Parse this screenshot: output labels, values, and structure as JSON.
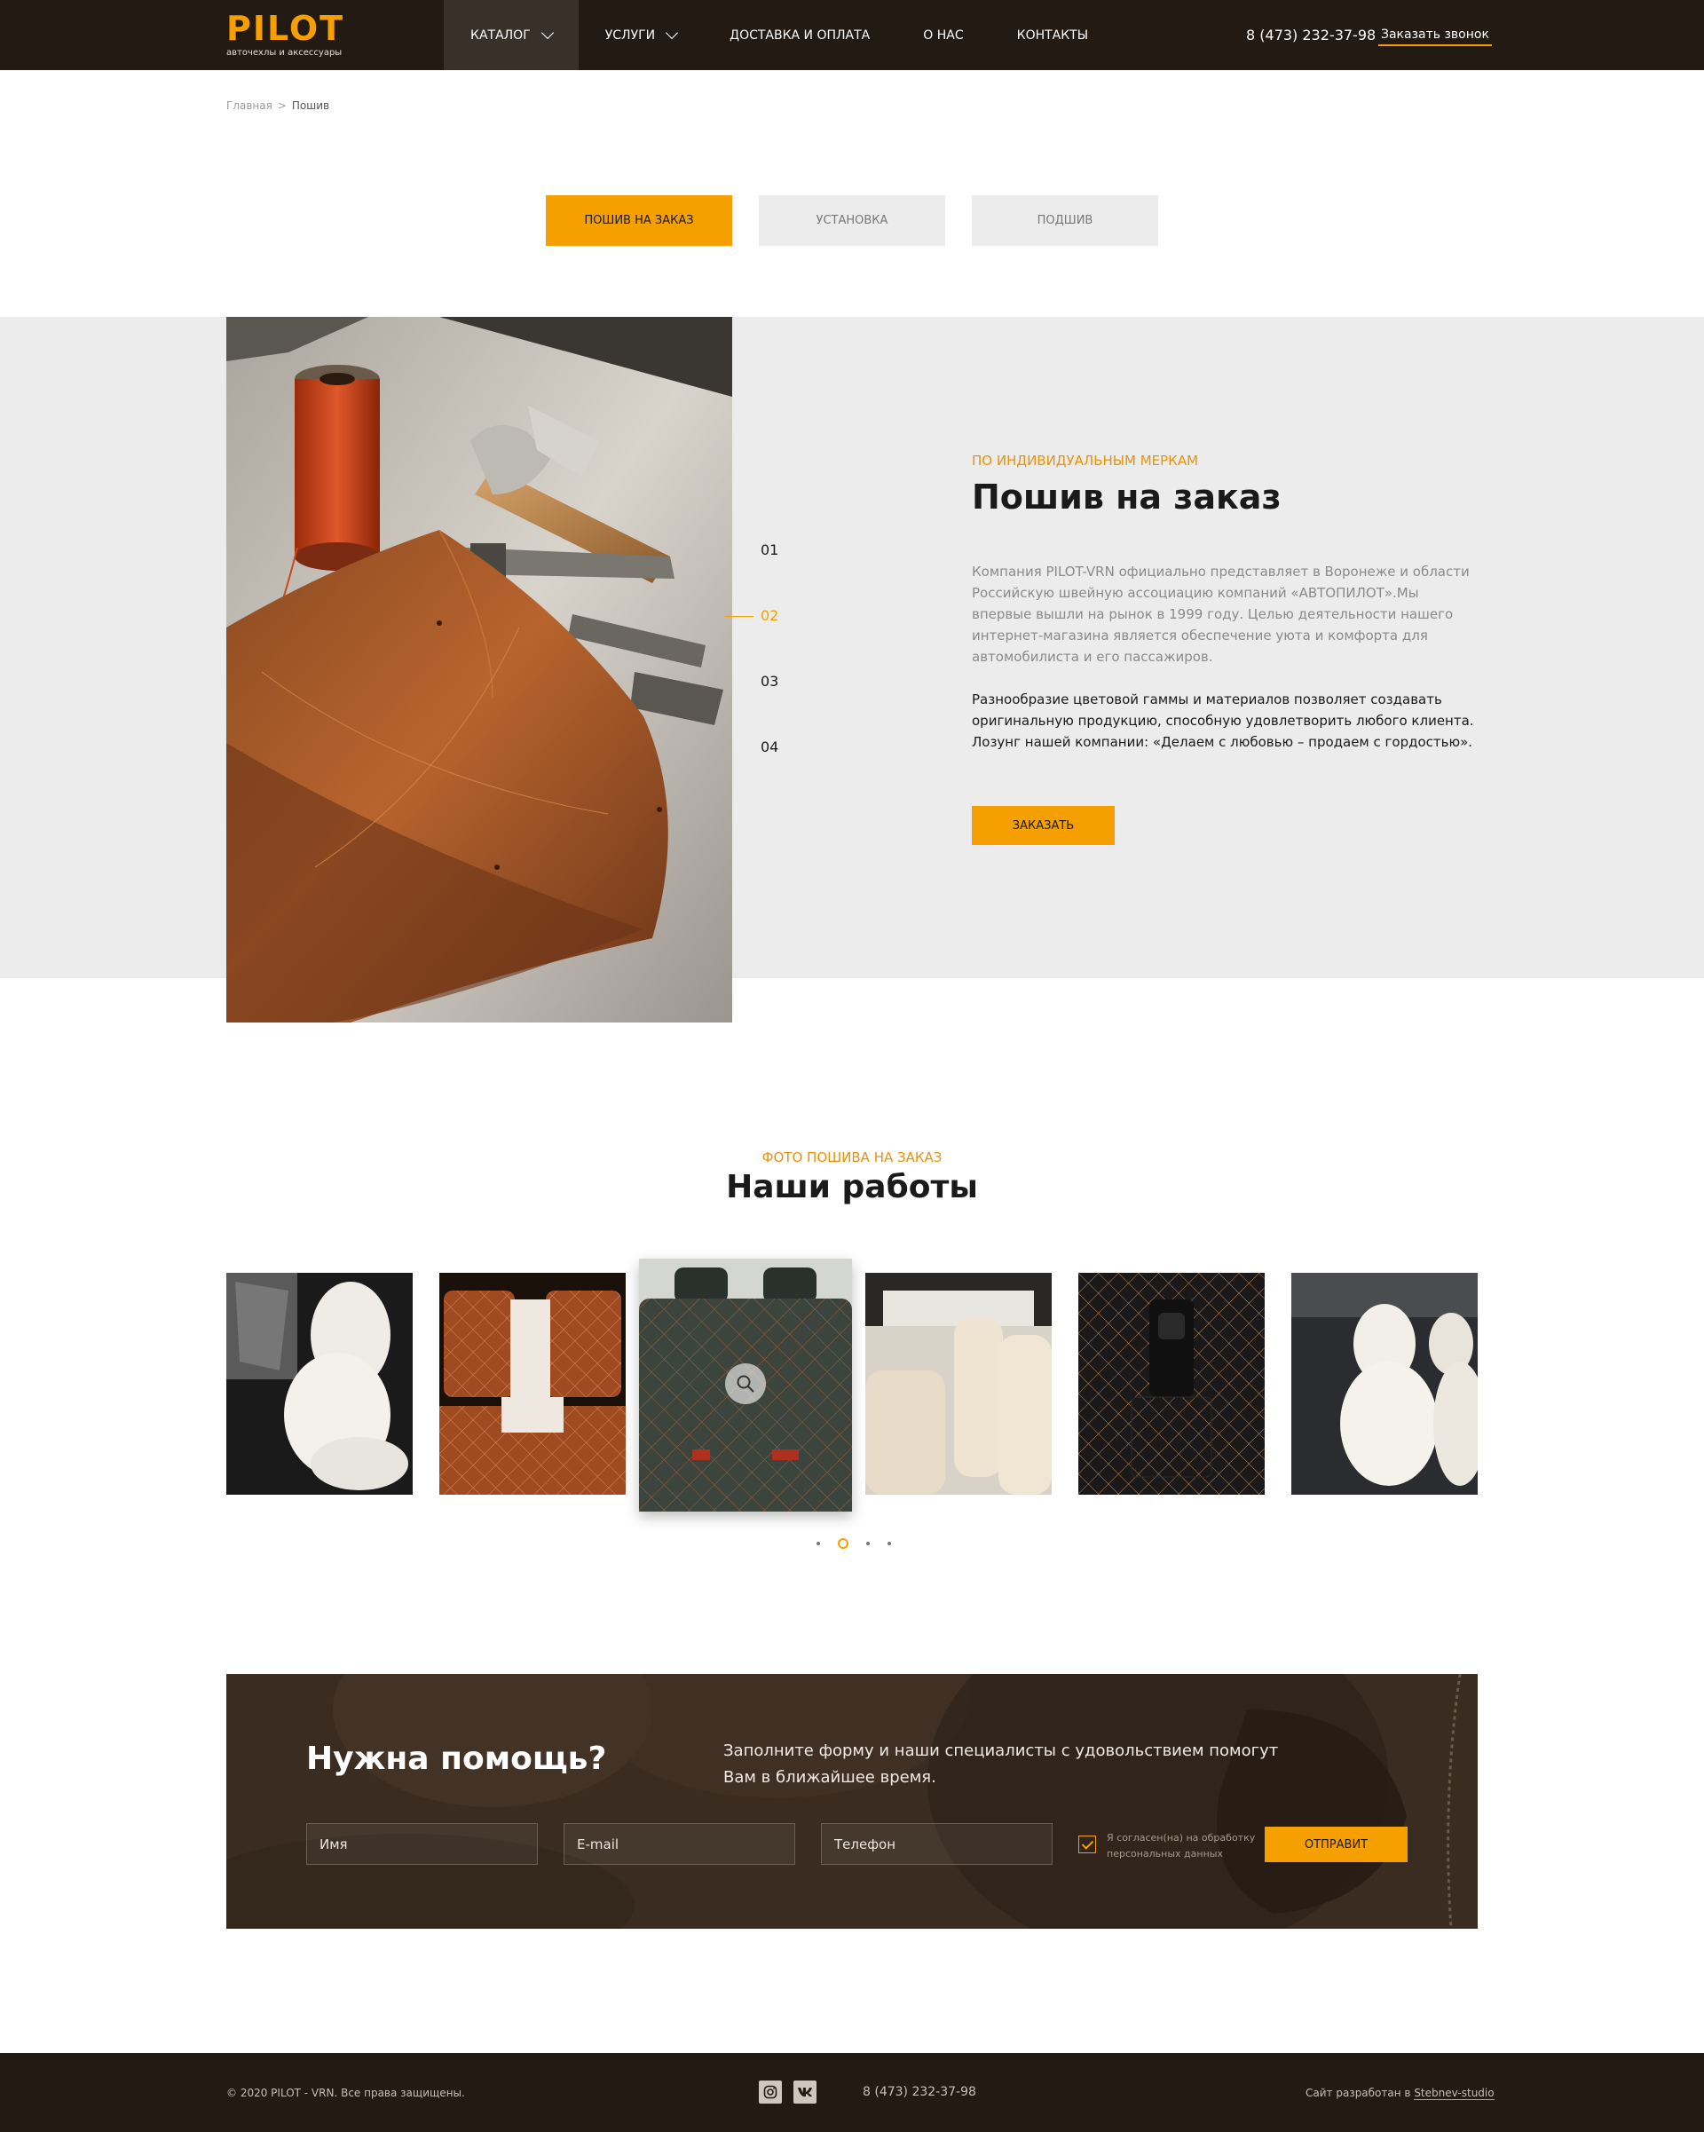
{
  "header": {
    "logo": "PILOT",
    "logo_sub": "авточехлы и аксессуары",
    "nav": [
      {
        "label": "КАТАЛОГ",
        "dropdown": true,
        "active": true
      },
      {
        "label": "УСЛУГИ",
        "dropdown": true
      },
      {
        "label": "ДОСТАВКА И ОПЛАТА"
      },
      {
        "label": "О НАС"
      },
      {
        "label": "КОНТАКТЫ"
      }
    ],
    "phone": "8 (473) 232-37-98",
    "callback": "Заказать звонок"
  },
  "breadcrumb": {
    "home": "Главная",
    "separator": ">",
    "current": "Пошив"
  },
  "tabs": [
    {
      "label": "ПОШИВ НА ЗАКАЗ",
      "active": true
    },
    {
      "label": "УСТАНОВКА"
    },
    {
      "label": "ПОДШИВ"
    }
  ],
  "hero": {
    "eyebrow": "ПО ИНДИВИДУАЛЬНЫМ МЕРКАМ",
    "title": "Пошив на заказ",
    "p1": "Компания PILOT-VRN официально представляет в Воронеже и области Российскую швейную ассоциацию компаний «АВТОПИЛОТ».Мы впервые вышли на рынок в 1999 году. Целью деятельности нашего интернет-магазина является обеспечение уюта и комфорта для автомобилиста и его пассажиров.",
    "p2": "Разнообразие цветовой гаммы и материалов позволяет создавать оригинальную продукцию, способную удовлетворить любого клиента. Лозунг нашей компании: «Делаем с любовью – продаем с гордостью».",
    "button": "ЗАКАЗАТЬ",
    "slides": [
      "01",
      "02",
      "03",
      "04"
    ],
    "active_slide": "02"
  },
  "works": {
    "eyebrow": "ФОТО ПОШИВА НА ЗАКАЗ",
    "title": "Наши работы",
    "pages": 4,
    "active_page": 2
  },
  "help": {
    "title": "Нужна помощь?",
    "description": "Заполните форму и наши специалисты с удовольствием помогут Вам в ближайшее время.",
    "name_placeholder": "Имя",
    "email_placeholder": "E-mail",
    "phone_placeholder": "Телефон",
    "consent": "Я согласен(на) на обработку персональных данных",
    "submit": "ОТПРАВИТ"
  },
  "footer": {
    "copyright": "© 2020 PILOT - VRN. Все права защищены.",
    "phone": "8 (473) 232-37-98",
    "dev_prefix": "Сайт разработан в",
    "dev_link": "Stebnev-studio",
    "icons": [
      "instagram-icon",
      "vk-icon"
    ]
  },
  "colors": {
    "accent": "#f5a000",
    "dark": "#231a14",
    "panel": "#ececec"
  }
}
